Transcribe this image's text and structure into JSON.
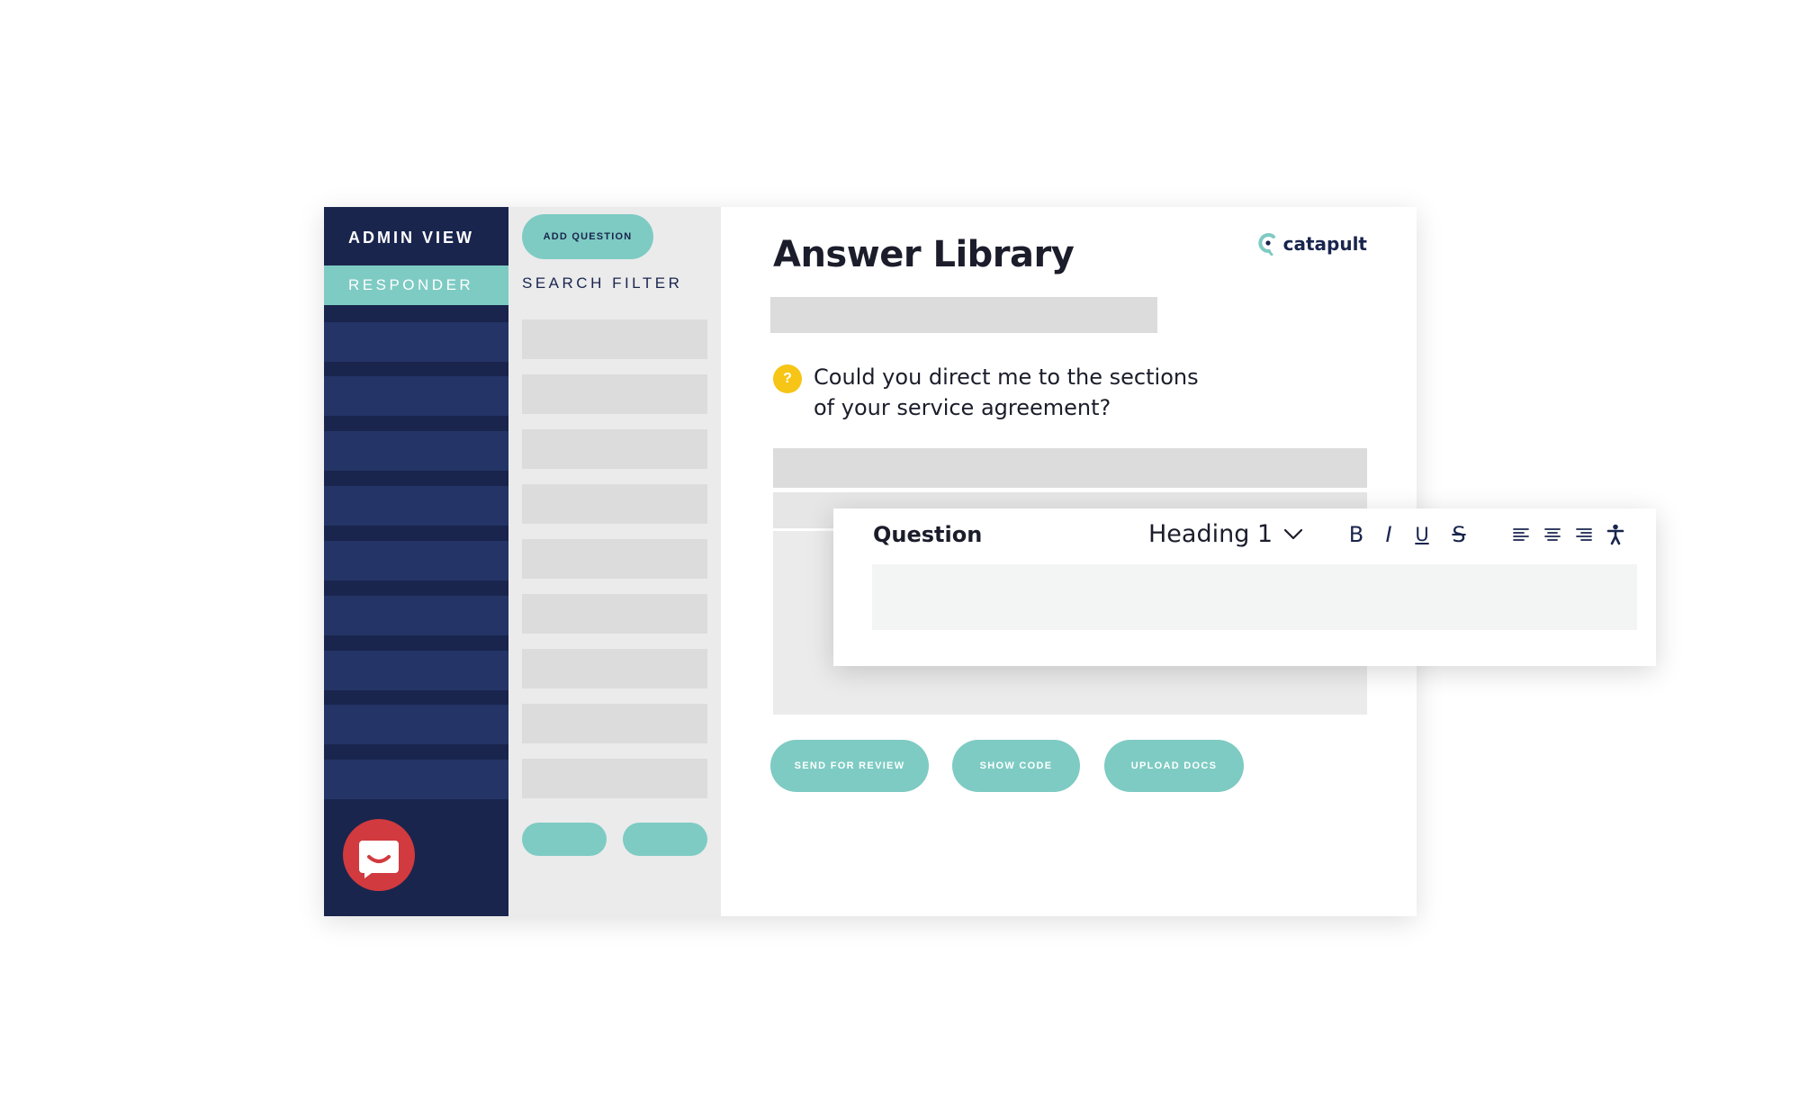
{
  "sidebar": {
    "title": "ADMIN VIEW",
    "active_tab": "RESPONDER",
    "nav_item_count": 9
  },
  "filter_panel": {
    "add_question_label": "ADD QUESTION",
    "search_filter_label": "SEARCH FILTER"
  },
  "main": {
    "page_title": "Answer Library",
    "brand_name": "catapult",
    "question_badge": "?",
    "question_line1": "Could you direct me to the sections",
    "question_line2": "of your service agreement?",
    "actions": {
      "send_for_review": "SEND FOR REVIEW",
      "show_code": "SHOW CODE",
      "upload_docs": "UPLOAD DOCS"
    }
  },
  "editor": {
    "label": "Question",
    "style_select": "Heading 1",
    "tools": {
      "bold": "B",
      "italic": "I",
      "underline": "U",
      "strikethrough": "S"
    }
  },
  "colors": {
    "navy": "#19254d",
    "navy_item": "#243466",
    "teal": "#7ecbc3",
    "yellow": "#f6c515",
    "red": "#d13a3e",
    "panel_gray": "#ebebec",
    "placeholder_gray": "#dcdcdd"
  },
  "icons": {
    "brand": "catapult-logo-icon",
    "app_logo": "smile-chat-icon",
    "dropdown": "chevron-down-icon",
    "align_left": "align-left-icon",
    "align_center": "align-center-icon",
    "align_right": "align-right-icon",
    "accessibility": "accessibility-icon"
  }
}
